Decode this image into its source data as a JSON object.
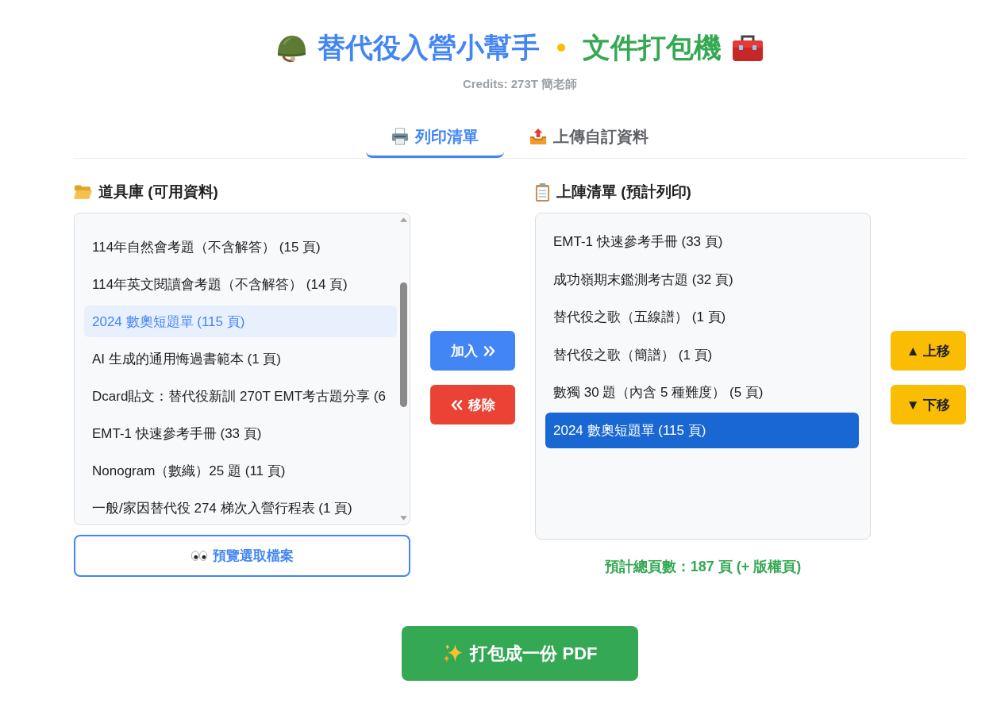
{
  "header": {
    "app_name": "替代役入營小幫手",
    "tool_name": "文件打包機",
    "credits": "Credits: 273T 簡老師"
  },
  "tabs": [
    {
      "label": "列印清單",
      "selected": true,
      "kind": "printer"
    },
    {
      "label": "上傳自訂資料",
      "selected": false,
      "kind": "upload"
    }
  ],
  "library": {
    "heading": "道具庫 (可用資料)",
    "items": [
      {
        "label": "114年自然會考題（不含解答） (15 頁)",
        "selected": false
      },
      {
        "label": "114年英文閱讀會考題（不含解答） (14 頁)",
        "selected": false
      },
      {
        "label": "2024 數奧短題單 (115 頁)",
        "selected": true
      },
      {
        "label": "AI 生成的通用悔過書範本 (1 頁)",
        "selected": false
      },
      {
        "label": "Dcard貼文：替代役新訓 270T EMT考古題分享 (6",
        "selected": false
      },
      {
        "label": "EMT-1 快速參考手冊 (33 頁)",
        "selected": false
      },
      {
        "label": "Nonogram（數織）25 題 (11 頁)",
        "selected": false
      },
      {
        "label": "一般/家因替代役 274 梯次入營行程表 (1 頁)",
        "selected": false
      }
    ],
    "preview_button": "預覽選取檔案"
  },
  "transfer": {
    "add_button": "加入",
    "remove_button": "移除"
  },
  "lineup": {
    "heading": "上陣清單 (預計列印)",
    "items": [
      {
        "label": "EMT-1 快速參考手冊 (33 頁)",
        "selected": false
      },
      {
        "label": "成功嶺期末鑑測考古題 (32 頁)",
        "selected": false
      },
      {
        "label": "替代役之歌（五線譜） (1 頁)",
        "selected": false
      },
      {
        "label": "替代役之歌（簡譜） (1 頁)",
        "selected": false
      },
      {
        "label": "數獨 30 題（內含 5 種難度） (5 頁)",
        "selected": false
      },
      {
        "label": "2024 數奧短題單 (115 頁)",
        "selected": true
      }
    ],
    "total": "預計總頁數：187 頁 (+ 版權頁)"
  },
  "order": {
    "up_button": "▲ 上移",
    "down_button": "▼ 下移"
  },
  "pack_button": "打包成一份 PDF"
}
